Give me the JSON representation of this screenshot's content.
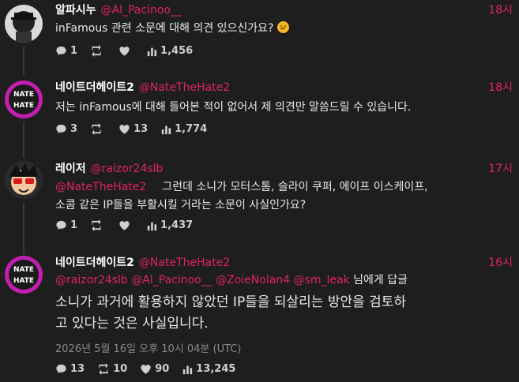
{
  "tweets": [
    {
      "name": "알파시누",
      "handle": "@Al_Pacinoo__",
      "time": "18시",
      "text": "inFamous 관련 소문에 대해 의견 있으신가요?",
      "emoji": "thinking-face",
      "stats": {
        "reply": "1",
        "retweet": "",
        "like": "",
        "views": "1,456"
      }
    },
    {
      "name": "네이트더헤이트2",
      "handle": "@NateTheHate2",
      "time": "18시",
      "text": "저는 inFamous에 대해 들어본 적이 없어서 제 의견만 말씀드릴 수 있습니다.",
      "stats": {
        "reply": "3",
        "retweet": "",
        "like": "13",
        "views": "1,774"
      }
    },
    {
      "name": "레이저",
      "handle": "@raizor24slb",
      "time": "17시",
      "mention": "@NateTheHate2",
      "text_line1": "그런데 소니가 모터스톰, 슬라이 쿠퍼, 에이프 이스케이프,",
      "text_line2": "소콤 같은 IP들을 부활시킬 거라는 소문이 사실인가요?",
      "stats": {
        "reply": "1",
        "retweet": "",
        "like": "",
        "views": "1,437"
      }
    },
    {
      "name": "네이트더헤이트2",
      "handle": "@NateTheHate2",
      "time": "16시",
      "reply_to": [
        "@raizor24slb",
        "@Al_Pacinoo__",
        "@ZoieNolan4",
        "@sm_leak"
      ],
      "reply_suffix": "님에게 답글",
      "text_line1": "소니가 과거에 활용하지 않았던 IP들을 되살리는 방안을 검토하",
      "text_line2": "고 있다는 것은 사실입니다.",
      "date": "2026년 5월 16일 오후 10시 04분 (UTC)",
      "stats": {
        "reply": "13",
        "retweet": "10",
        "like": "90",
        "views": "13,245"
      }
    }
  ],
  "colors": {
    "accent": "#e0245e",
    "background": "#1e1e1e",
    "text": "#e8e8e8"
  }
}
